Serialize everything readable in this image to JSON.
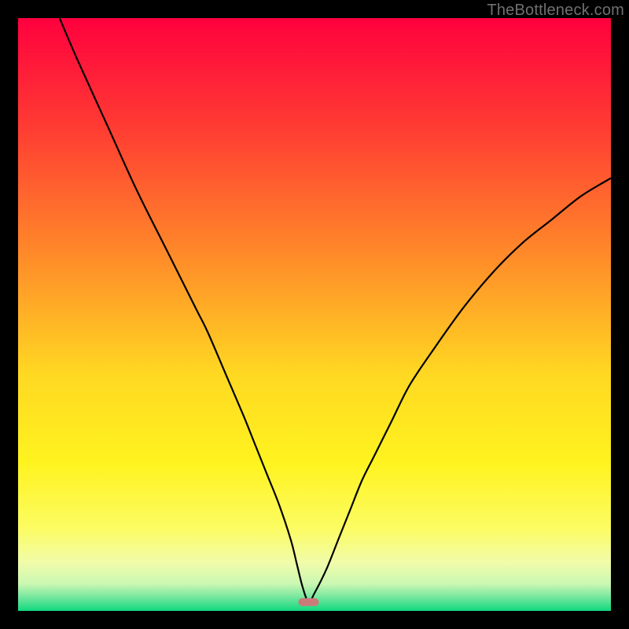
{
  "watermark": "TheBottleneck.com",
  "chart_data": {
    "type": "line",
    "title": "",
    "xlabel": "",
    "ylabel": "",
    "xlim": [
      0,
      100
    ],
    "ylim": [
      0,
      100
    ],
    "grid": false,
    "legend": false,
    "marker": {
      "x": 49,
      "y": 1.5,
      "color": "#cc7a7a"
    },
    "series": [
      {
        "name": "curve",
        "color": "#000000",
        "x": [
          7,
          10,
          15,
          20,
          25,
          30,
          32,
          35,
          38,
          40,
          42,
          44,
          46,
          47,
          48,
          49,
          50,
          52,
          54,
          56,
          58,
          60,
          63,
          66,
          70,
          75,
          80,
          85,
          90,
          95,
          100
        ],
        "y": [
          100,
          93,
          82,
          71,
          61,
          51,
          47,
          40,
          33,
          28,
          23,
          18,
          12,
          8,
          4,
          1.5,
          3,
          7,
          12,
          17,
          22,
          26,
          32,
          38,
          44,
          51,
          57,
          62,
          66,
          70,
          73
        ]
      }
    ],
    "background_gradient": {
      "stops": [
        {
          "offset": 0.0,
          "color": "#ff003e"
        },
        {
          "offset": 0.18,
          "color": "#ff3a33"
        },
        {
          "offset": 0.4,
          "color": "#ff8a29"
        },
        {
          "offset": 0.6,
          "color": "#ffd822"
        },
        {
          "offset": 0.75,
          "color": "#fff31f"
        },
        {
          "offset": 0.86,
          "color": "#fcfc62"
        },
        {
          "offset": 0.92,
          "color": "#f0fcaa"
        },
        {
          "offset": 0.955,
          "color": "#c9f7b2"
        },
        {
          "offset": 0.975,
          "color": "#7ce8a0"
        },
        {
          "offset": 1.0,
          "color": "#10d87f"
        }
      ]
    }
  }
}
